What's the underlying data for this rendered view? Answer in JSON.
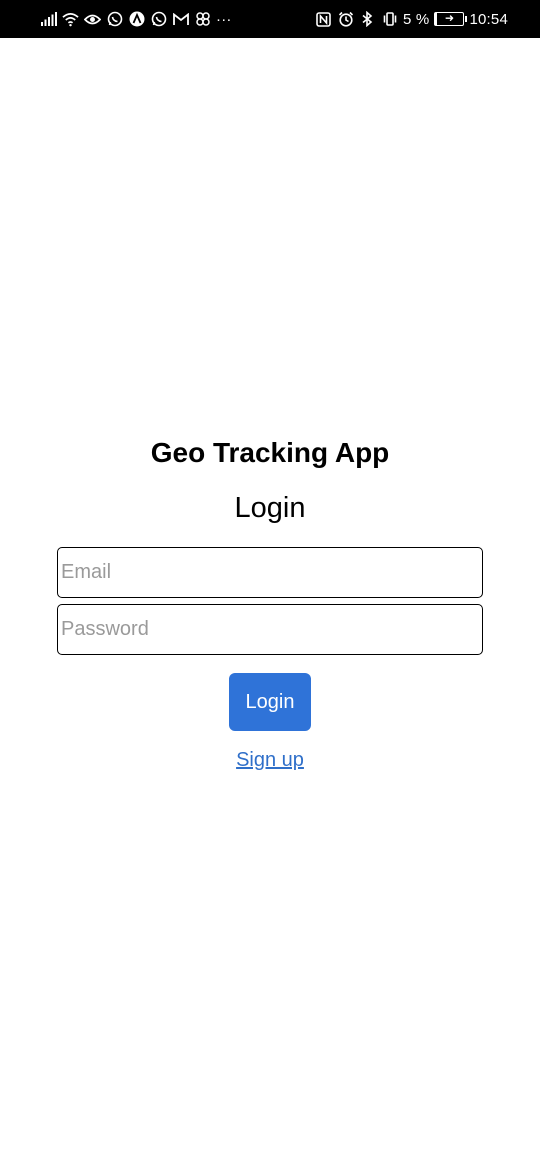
{
  "status_bar": {
    "left_icons": [
      "signal-icon",
      "wifi-icon",
      "eye-icon",
      "whatsapp-icon",
      "app-a-icon",
      "whatsapp-icon",
      "gmail-icon",
      "pinwheel-icon",
      "more-icon"
    ],
    "more_glyph": "···",
    "right_icons": [
      "nfc-icon",
      "alarm-icon",
      "bluetooth-icon",
      "vibrate-icon"
    ],
    "battery_text": "5 %",
    "battery_level": 0.05,
    "time": "10:54"
  },
  "app": {
    "title": "Geo Tracking App",
    "screen_title": "Login"
  },
  "form": {
    "email_placeholder": "Email",
    "email_value": "",
    "password_placeholder": "Password",
    "password_value": "",
    "login_label": "Login",
    "signup_label": "Sign up"
  },
  "colors": {
    "primary": "#2f73d8",
    "link": "#2f6fc9",
    "placeholder": "#9a9a9a",
    "status_bar_bg": "#000000"
  }
}
